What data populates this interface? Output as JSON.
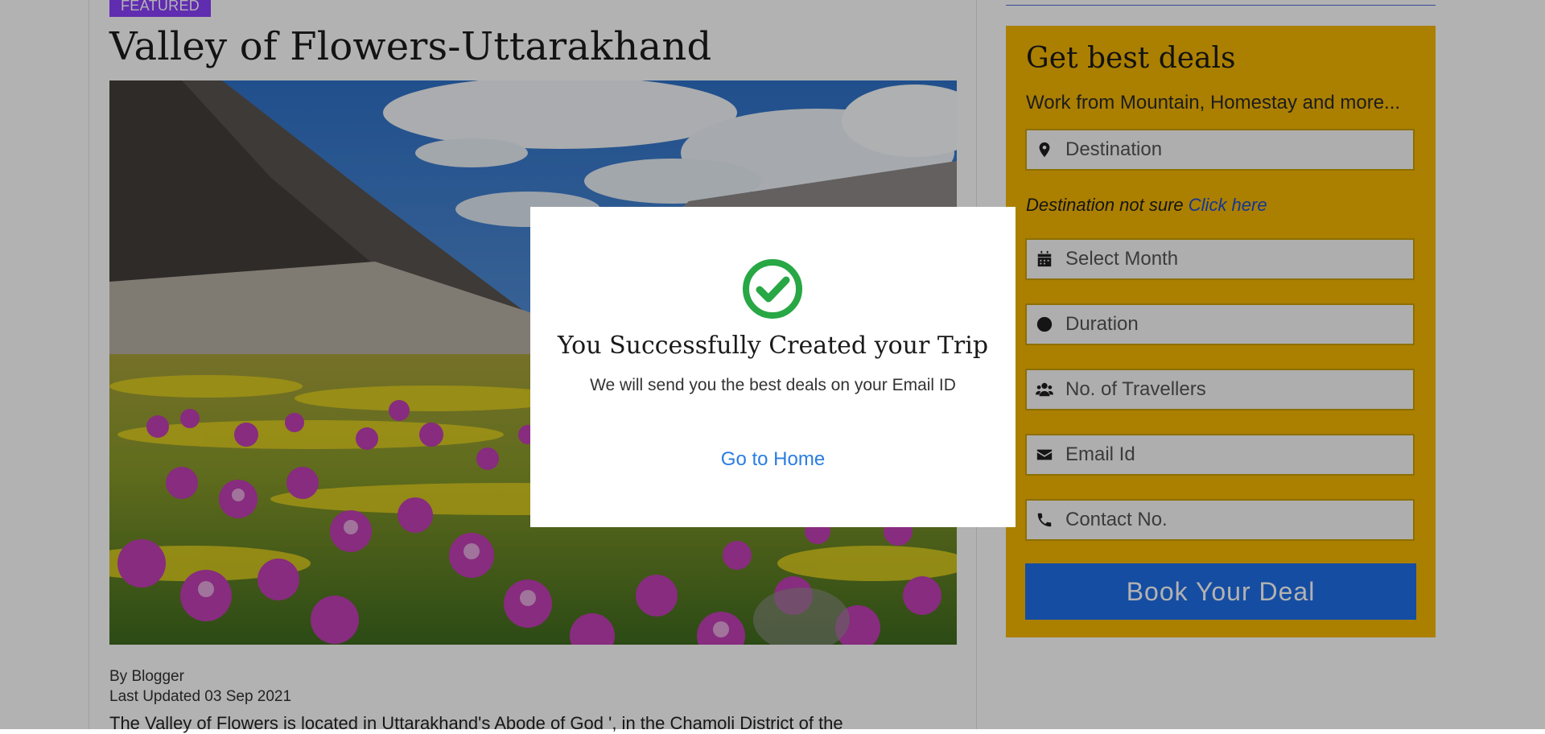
{
  "article": {
    "badge": "FEATURED",
    "title": "Valley of Flowers-Uttarakhand",
    "author": "By Blogger",
    "updated": "Last Updated 03 Sep 2021",
    "intro": "The Valley of Flowers is located in Uttarakhand's Abode of God ', in the Chamoli District of the"
  },
  "deal_form": {
    "title": "Get best deals",
    "subtitle": "Work from Mountain, Homestay and more...",
    "destination_placeholder": "Destination",
    "note_prefix": "Destination not sure ",
    "note_link": "Click here",
    "month_placeholder": "Select Month",
    "duration_placeholder": "Duration",
    "travellers_placeholder": "No. of Travellers",
    "email_placeholder": "Email Id",
    "contact_placeholder": "Contact No.",
    "submit_label": "Book Your Deal",
    "background_color": "#f5b700",
    "button_color": "#1f6fe8",
    "icons": [
      "map-marker-icon",
      "calendar-icon",
      "clock-icon",
      "users-icon",
      "envelope-icon",
      "phone-icon"
    ]
  },
  "modal": {
    "icon": "check-circle-icon",
    "title": "You Successfully Created your Trip",
    "message": "We will send you the best deals on your Email ID",
    "link": "Go to Home",
    "accent_color": "#28a745",
    "link_color": "#2a7de1"
  },
  "colors": {
    "badge": "#8a3ffc",
    "overlay": "rgba(0,0,0,0.30)"
  }
}
